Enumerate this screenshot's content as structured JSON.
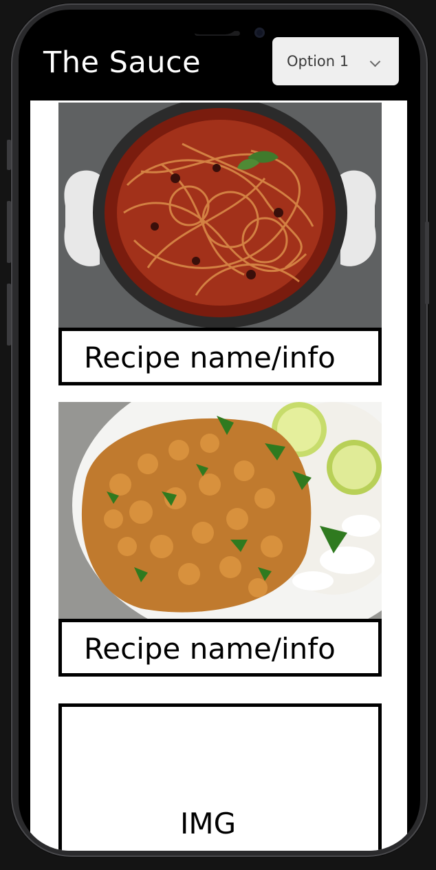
{
  "app": {
    "title": "The Sauce"
  },
  "dropdown": {
    "selected": "Option 1",
    "icon": "chevron-down-icon"
  },
  "recipes": [
    {
      "name": "Recipe name/info",
      "image": "spaghetti-pot-photo"
    },
    {
      "name": "Recipe name/info",
      "image": "chickpea-curry-rice-photo"
    }
  ],
  "placeholder": {
    "label": "IMG"
  }
}
